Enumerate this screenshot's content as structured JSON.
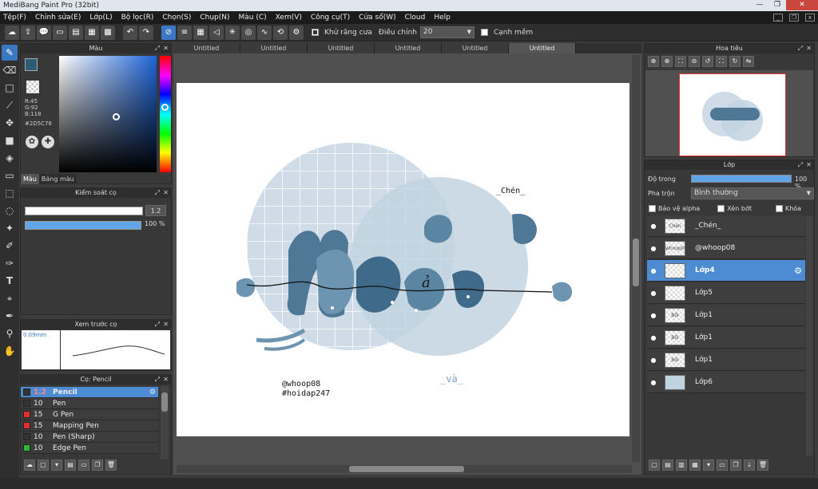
{
  "window": {
    "title": "MediBang Paint Pro (32bit)",
    "min_icon": "minimize-icon",
    "max_icon": "maximize-icon",
    "close_icon": "close-icon"
  },
  "menu": [
    "Tệp(F)",
    "Chỉnh sửa(E)",
    "Lớp(L)",
    "Bộ lọc(R)",
    "Chọn(S)",
    "Chụp(N)",
    "Màu (C)",
    "Xem(V)",
    "Công cụ(T)",
    "Cửa sổ(W)",
    "Cloud",
    "Help"
  ],
  "toolbar": {
    "antialias_label": "Khử răng cưa",
    "correction_label": "Điều chỉnh",
    "correction_value": "20",
    "edge_label": "Cạnh mềm"
  },
  "color_panel": {
    "title": "Màu",
    "r": "R:45",
    "g": "G:92",
    "b": "B:118",
    "hex": "#2D5C76",
    "tab_color": "Màu",
    "tab_palette": "Bảng màu",
    "fg_color": "#2d5c76",
    "bg_color": "#55d433"
  },
  "brush_control": {
    "title": "Kiểm soát cọ",
    "size_value": "1.2",
    "opacity_value": "100 %"
  },
  "brush_preview": {
    "title": "Xem trước cọ",
    "size_label": "0.09mm"
  },
  "brush_list": {
    "title": "Cọ: Pencil",
    "items": [
      {
        "size": "1.2",
        "name": "Pencil",
        "color": "#333333"
      },
      {
        "size": "10",
        "name": "Pen",
        "color": "#333333"
      },
      {
        "size": "15",
        "name": "G Pen",
        "color": "#e03030"
      },
      {
        "size": "15",
        "name": "Mapping Pen",
        "color": "#e03030"
      },
      {
        "size": "10",
        "name": "Pen (Sharp)",
        "color": "#333333"
      },
      {
        "size": "10",
        "name": "Edge Pen",
        "color": "#33b833"
      }
    ]
  },
  "tabs": [
    "Untitled",
    "Untitled",
    "Untitled",
    "Untitled",
    "Untitled",
    "Untitled"
  ],
  "artwork": {
    "word_top": "_Chén_",
    "word_bottom": "_và_",
    "handle": "@whoop08",
    "hashtag": "#hoidap247",
    "script_text": "ả"
  },
  "navigator": {
    "title": "Hoa tiêu"
  },
  "layers_panel": {
    "title": "Lớp",
    "opacity_label": "Độ trong",
    "opacity_value": "100 %",
    "blend_label": "Pha trộn",
    "blend_value": "Bình thường",
    "protect_alpha": "Bảo vệ alpha",
    "clipping": "Xén bớt",
    "lock": "Khóa",
    "layers": [
      {
        "name": "_Chén_",
        "thumb": "Chén"
      },
      {
        "name": "@whoop08",
        "thumb": "whoop08"
      },
      {
        "name": "Lớp4",
        "thumb": ""
      },
      {
        "name": "Lớp5",
        "thumb": ""
      },
      {
        "name": "Lớp1",
        "thumb": "Bồi"
      },
      {
        "name": "Lớp1",
        "thumb": "Bồi"
      },
      {
        "name": "Lớp1",
        "thumb": "Bồi"
      },
      {
        "name": "Lớp6",
        "thumb": ""
      }
    ]
  }
}
